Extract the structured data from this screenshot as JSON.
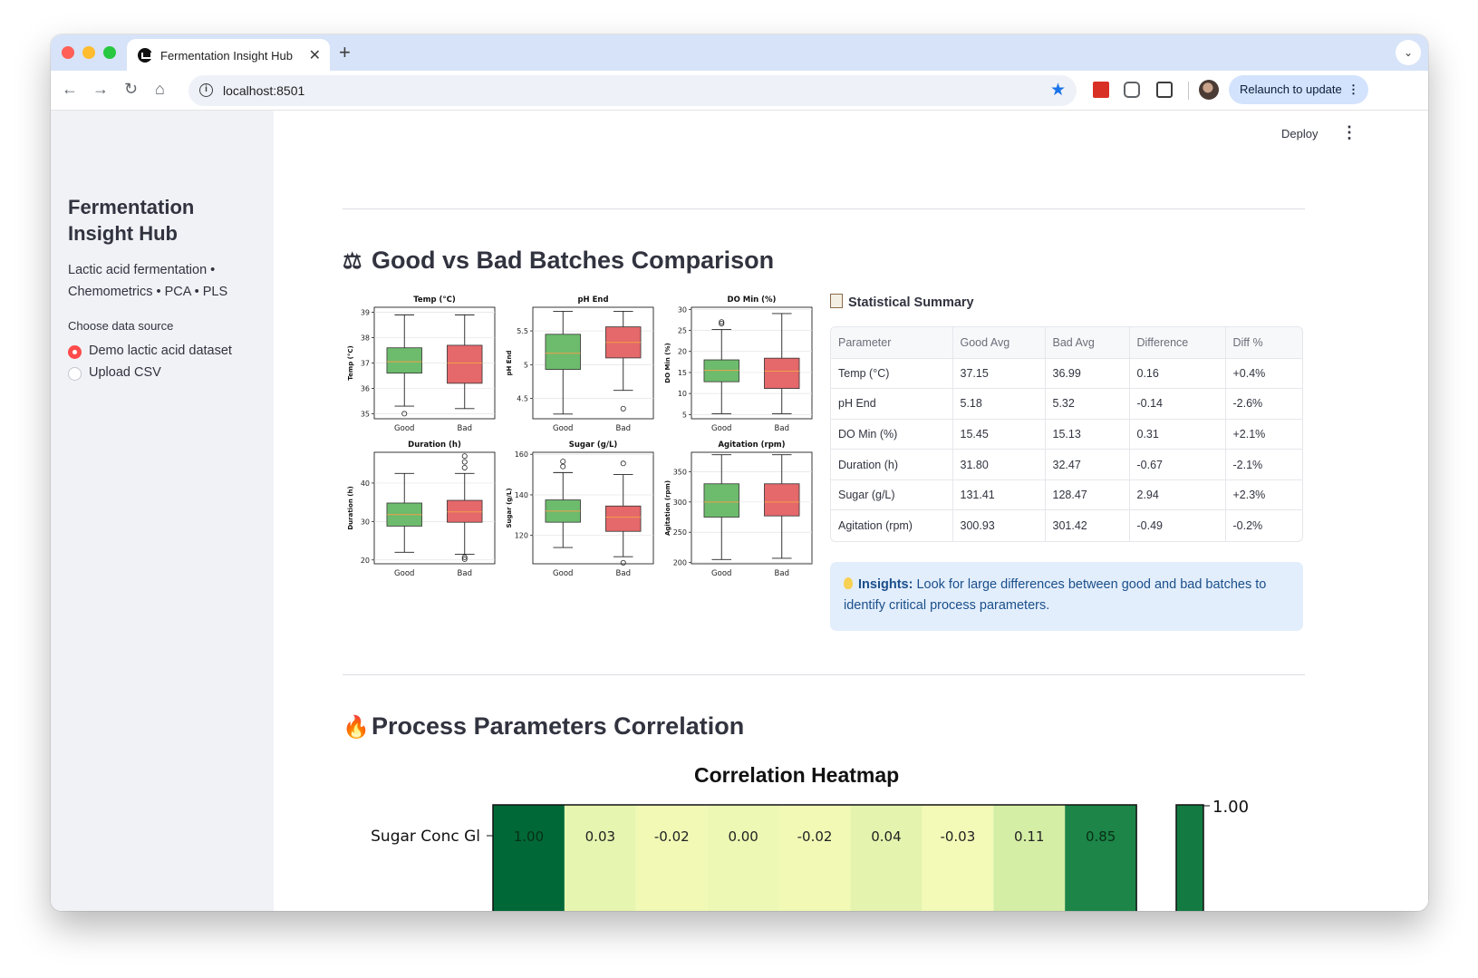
{
  "browser": {
    "tab_title": "Fermentation Insight Hub",
    "url": "localhost:8501",
    "relaunch_label": "Relaunch to update",
    "icons": [
      "back-icon",
      "forward-icon",
      "reload-icon",
      "home-icon",
      "info-icon",
      "star-icon",
      "extension-icon",
      "puzzle-icon",
      "avatar"
    ]
  },
  "app": {
    "deploy_label": "Deploy",
    "menu_glyph": "⋮"
  },
  "sidebar": {
    "title": "Fermentation Insight Hub",
    "description": "Lactic acid fermentation • Chemometrics • PCA • PLS",
    "data_source_label": "Choose data source",
    "options": [
      "Demo lactic acid dataset",
      "Upload CSV"
    ],
    "selected_option": "Demo lactic acid dataset"
  },
  "sections": {
    "comparison_title": "Good vs Bad Batches Comparison",
    "comparison_icon": "balance-scale-icon",
    "correlation_title": "Process Parameters Correlation",
    "correlation_icon": "fire-icon"
  },
  "stats": {
    "title": "Statistical Summary",
    "columns": [
      "Parameter",
      "Good Avg",
      "Bad Avg",
      "Difference",
      "Diff %"
    ],
    "rows": [
      [
        "Temp (°C)",
        "37.15",
        "36.99",
        "0.16",
        "+0.4%"
      ],
      [
        "pH End",
        "5.18",
        "5.32",
        "-0.14",
        "-2.6%"
      ],
      [
        "DO Min (%)",
        "15.45",
        "15.13",
        "0.31",
        "+2.1%"
      ],
      [
        "Duration (h)",
        "31.80",
        "32.47",
        "-0.67",
        "-2.1%"
      ],
      [
        "Sugar (g/L)",
        "131.41",
        "128.47",
        "2.94",
        "+2.3%"
      ],
      [
        "Agitation (rpm)",
        "300.93",
        "301.42",
        "-0.49",
        "-0.2%"
      ]
    ]
  },
  "insight": {
    "label": "Insights:",
    "text": "Look for large differences between good and bad batches to identify critical process parameters."
  },
  "chart_data": [
    {
      "type": "box",
      "groups": [
        "Good",
        "Bad"
      ],
      "colors": {
        "Good": "#6dbb6d",
        "Bad": "#e5686a",
        "median": "#f0a04b"
      },
      "panels": [
        {
          "title": "Temp (°C)",
          "ylabel": "Temp (°C)",
          "ylim": [
            34.8,
            39.2
          ],
          "ticks": [
            35,
            36,
            37,
            38,
            39
          ],
          "Good": {
            "whislo": 35.3,
            "q1": 36.6,
            "med": 37.05,
            "q3": 37.6,
            "whishi": 38.9,
            "fliers": [
              35.0
            ]
          },
          "Bad": {
            "whislo": 35.2,
            "q1": 36.2,
            "med": 37.0,
            "q3": 37.7,
            "whishi": 38.9,
            "fliers": []
          }
        },
        {
          "title": "pH End",
          "ylabel": "pH End",
          "ylim": [
            4.2,
            5.85
          ],
          "ticks": [
            4.5,
            5.0,
            5.5
          ],
          "Good": {
            "whislo": 4.27,
            "q1": 4.93,
            "med": 5.17,
            "q3": 5.45,
            "whishi": 5.79,
            "fliers": []
          },
          "Bad": {
            "whislo": 4.62,
            "q1": 5.1,
            "med": 5.33,
            "q3": 5.56,
            "whishi": 5.79,
            "fliers": [
              4.35
            ]
          }
        },
        {
          "title": "DO Min (%)",
          "ylabel": "DO Min (%)",
          "ylim": [
            4,
            30.5
          ],
          "ticks": [
            5,
            10,
            15,
            20,
            25,
            30
          ],
          "Good": {
            "whislo": 5.2,
            "q1": 12.8,
            "med": 15.5,
            "q3": 18.0,
            "whishi": 25.2,
            "fliers": [
              26.6,
              27.0
            ]
          },
          "Bad": {
            "whislo": 5.2,
            "q1": 11.2,
            "med": 15.3,
            "q3": 18.4,
            "whishi": 29.0,
            "fliers": []
          }
        },
        {
          "title": "Duration (h)",
          "ylabel": "Duration (h)",
          "ylim": [
            19,
            48
          ],
          "ticks": [
            20,
            30,
            40
          ],
          "Good": {
            "whislo": 22.0,
            "q1": 28.8,
            "med": 31.8,
            "q3": 34.8,
            "whishi": 42.5,
            "fliers": []
          },
          "Bad": {
            "whislo": 21.5,
            "q1": 29.8,
            "med": 32.5,
            "q3": 35.5,
            "whishi": 42.5,
            "fliers": [
              20.2,
              20.7,
              44.0,
              45.5,
              47.0
            ]
          }
        },
        {
          "title": "Sugar (g/L)",
          "ylabel": "Sugar (g/L)",
          "ylim": [
            106,
            161
          ],
          "ticks": [
            120,
            140,
            160
          ],
          "Good": {
            "whislo": 114.0,
            "q1": 126.5,
            "med": 132.0,
            "q3": 137.5,
            "whishi": 151.0,
            "fliers": [
              154.0,
              156.5
            ]
          },
          "Bad": {
            "whislo": 109.5,
            "q1": 122.0,
            "med": 129.0,
            "q3": 134.5,
            "whishi": 150.0,
            "fliers": [
              106.5,
              155.5
            ]
          }
        },
        {
          "title": "Agitation (rpm)",
          "ylabel": "Agitation (rpm)",
          "ylim": [
            198,
            382
          ],
          "ticks": [
            200,
            250,
            300,
            350
          ],
          "Good": {
            "whislo": 205,
            "q1": 275,
            "med": 300,
            "q3": 330,
            "whishi": 378,
            "fliers": []
          },
          "Bad": {
            "whislo": 207,
            "q1": 277,
            "med": 300,
            "q3": 330,
            "whishi": 378,
            "fliers": []
          }
        }
      ]
    },
    {
      "type": "heatmap",
      "title": "Correlation Heatmap",
      "row_labels": [
        "Sugar Conc Gl"
      ],
      "values": [
        [
          1.0,
          0.03,
          -0.02,
          0.0,
          -0.02,
          0.04,
          -0.03,
          0.11,
          0.85
        ]
      ],
      "colorbar_ticks": [
        "1.00"
      ],
      "colormap": "Greens"
    }
  ]
}
